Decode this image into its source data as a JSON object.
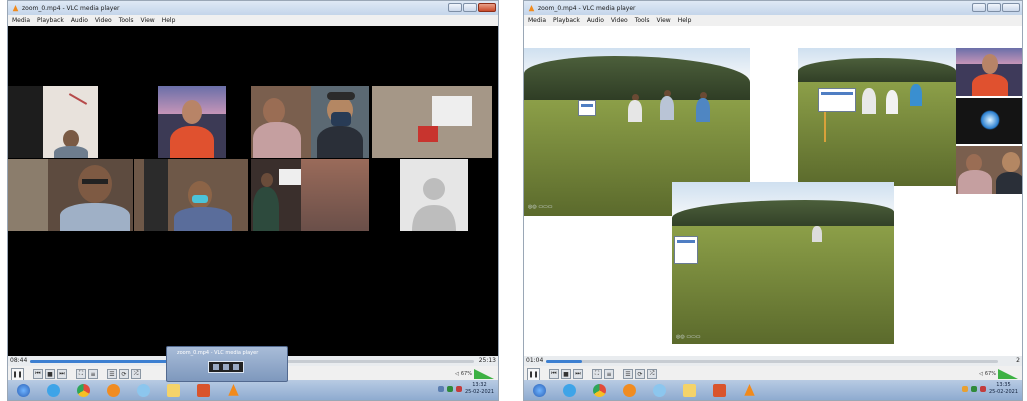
{
  "window_title": "zoom_0.mp4 - VLC media player",
  "menu": [
    "Media",
    "Playback",
    "Audio",
    "Video",
    "Tools",
    "View",
    "Help"
  ],
  "left": {
    "elapsed": "08:44",
    "total": "25:13",
    "progress_fraction": 0.35,
    "volume": "67%",
    "clock_time": "13:32",
    "clock_date": "25-02-2021",
    "popup_title": "zoom_0.mp4 - VLC media player"
  },
  "right": {
    "elapsed": "01:04",
    "total": "2",
    "progress_fraction": 0.08,
    "volume": "67%",
    "clock_time": "13:35",
    "clock_date": "25-02-2021"
  },
  "colors": {
    "seek_fill": "#3c7fd1",
    "taskbar": "#9db6d8",
    "vlc_orange": "#f18a1c"
  },
  "icons": {
    "controls": [
      "pause-icon",
      "previous-icon",
      "stop-icon",
      "next-icon",
      "fullscreen-icon",
      "extended-settings-icon",
      "playlist-icon",
      "loop-icon",
      "shuffle-icon"
    ],
    "taskbar": [
      "windows-start-icon",
      "internet-explorer-icon",
      "chrome-icon",
      "media-player-icon",
      "messenger-icon",
      "file-explorer-icon",
      "presentation-icon",
      "vlc-icon"
    ]
  }
}
